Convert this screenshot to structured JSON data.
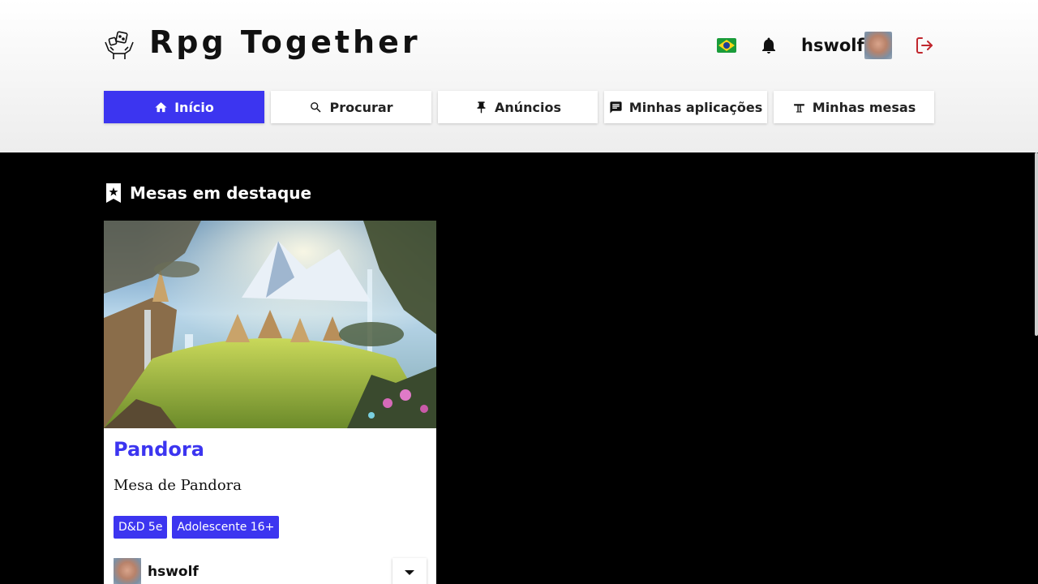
{
  "app": {
    "brand": "Rpg Together"
  },
  "header": {
    "username": "hswolf",
    "language_icon": "brazil-flag-icon",
    "notifications_icon": "bell-icon",
    "logout_icon": "logout-icon"
  },
  "nav": {
    "items": [
      {
        "label": "Início",
        "icon": "home-icon",
        "active": true
      },
      {
        "label": "Procurar",
        "icon": "search-icon",
        "active": false
      },
      {
        "label": "Anúncios",
        "icon": "pin-icon",
        "active": false
      },
      {
        "label": "Minhas aplicações",
        "icon": "message-icon",
        "active": false
      },
      {
        "label": "Minhas mesas",
        "icon": "table-icon",
        "active": false
      }
    ]
  },
  "main": {
    "section_title": "Mesas em destaque",
    "card": {
      "title": "Pandora",
      "description": "Mesa de Pandora",
      "tags": [
        "D&D 5e",
        "Adolescente 16+"
      ],
      "owner": "hswolf"
    }
  },
  "colors": {
    "accent": "#3c35f0",
    "logout": "#c0262d"
  }
}
